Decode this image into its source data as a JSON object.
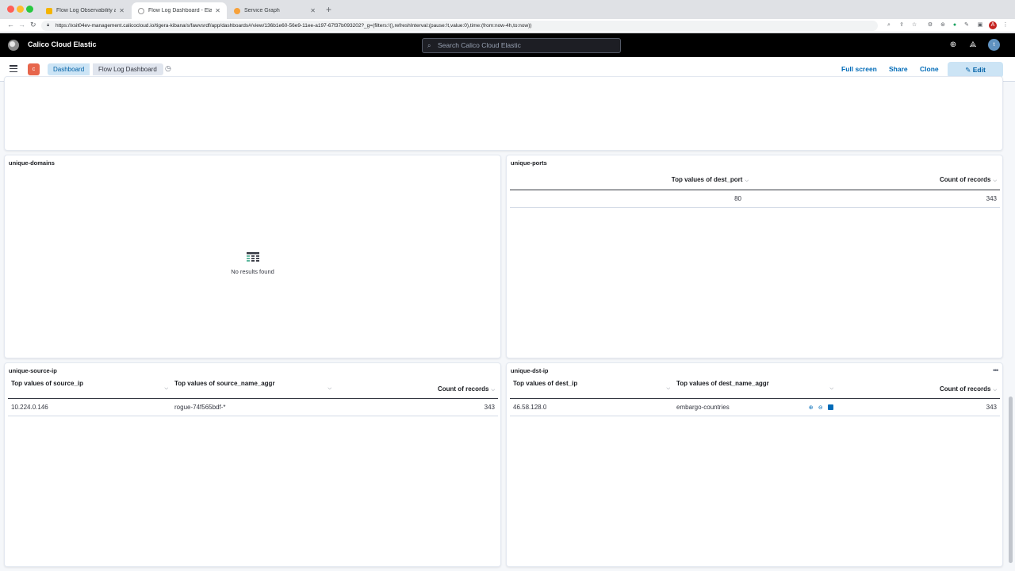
{
  "browser": {
    "tabs": [
      {
        "label": "Flow Log Observability and Tro",
        "active": false
      },
      {
        "label": "Flow Log Dashboard - Elastic",
        "active": true
      },
      {
        "label": "Service Graph",
        "active": false
      }
    ],
    "url": "https://xsit04ev-management.calicocloud.io/tigera-kibana/s/fawvsrdf/app/dashboards#/view/136b1e60-56e9-11ee-a197-67f37b093202?_g=(filters:!(),refreshInterval:(pause:!t,value:0),time:(from:now-4h,to:now))",
    "profile_initial": "A"
  },
  "header": {
    "brand": "Calico Cloud Elastic",
    "search_placeholder": "Search Calico Cloud Elastic",
    "avatar_initial": "t"
  },
  "breadcrumb": {
    "space_badge": "c",
    "items": [
      "Dashboard",
      "Flow Log Dashboard"
    ],
    "actions": {
      "full_screen": "Full screen",
      "share": "Share",
      "clone": "Clone",
      "edit": "Edit"
    }
  },
  "panels": {
    "domains": {
      "title": "unique-domains",
      "empty_text": "No results found"
    },
    "ports": {
      "title": "unique-ports",
      "columns": [
        "Top values of dest_port",
        "Count of records"
      ],
      "rows": [
        [
          "80",
          "343"
        ]
      ]
    },
    "source_ip": {
      "title": "unique-source-ip",
      "columns": [
        "Top values of source_ip",
        "Top values of source_name_aggr",
        "Count of records"
      ],
      "rows": [
        [
          "10.224.0.146",
          "rogue-74f565bdf-*",
          "343"
        ]
      ]
    },
    "dst_ip": {
      "title": "unique-dst-ip",
      "columns": [
        "Top values of dest_ip",
        "Top values of dest_name_aggr",
        "Count of records"
      ],
      "rows": [
        [
          "46.58.128.0",
          "embargo-countries",
          "343"
        ]
      ]
    }
  },
  "colors": {
    "accent": "#006bb8",
    "header_bg": "#000000",
    "space_badge": "#e7664c",
    "crumb_active": "#cce4f5"
  }
}
